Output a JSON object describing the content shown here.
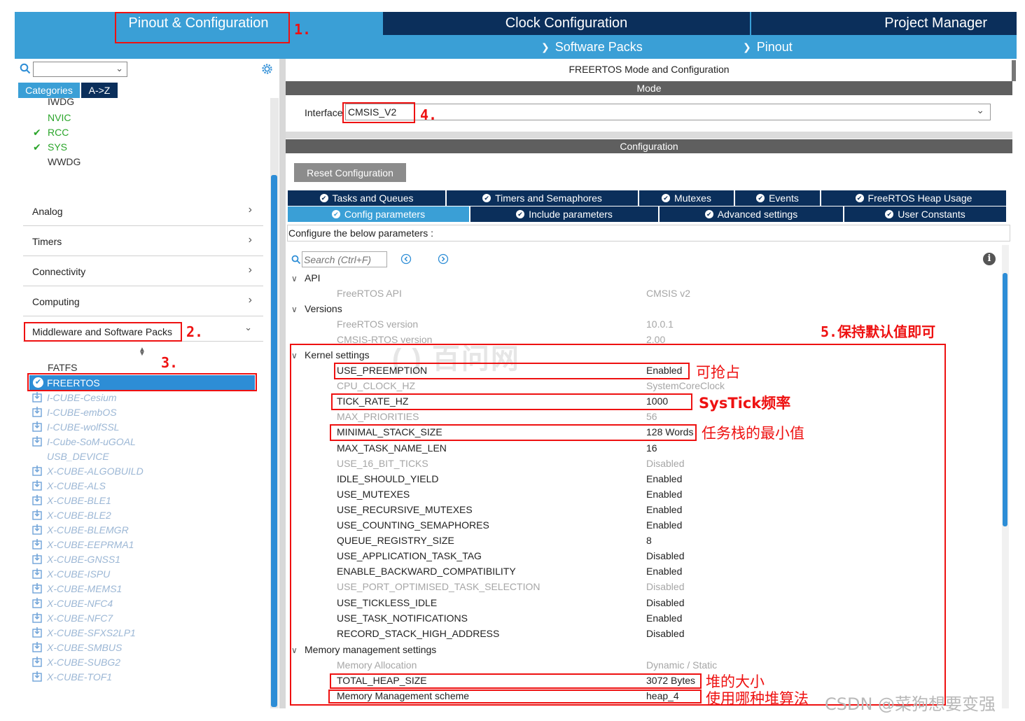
{
  "top_tabs": {
    "pinout": "Pinout & Configuration",
    "clock": "Clock Configuration",
    "project": "Project Manager",
    "software_packs": "Software Packs",
    "pinout_sub": "Pinout"
  },
  "left": {
    "search_value": "",
    "categories_tab": "Categories",
    "az_tab": "A->Z",
    "system_items": [
      "IWDG",
      "NVIC",
      "RCC",
      "SYS",
      "WWDG"
    ],
    "category_rows": [
      "Analog",
      "Timers",
      "Connectivity",
      "Computing",
      "Middleware and Software Packs"
    ],
    "middleware_items": {
      "fatfs": "FATFS",
      "freertos": "FREERTOS",
      "packs": [
        "I-CUBE-Cesium",
        "I-CUBE-embOS",
        "I-CUBE-wolfSSL",
        "I-Cube-SoM-uGOAL",
        "USB_DEVICE",
        "X-CUBE-ALGOBUILD",
        "X-CUBE-ALS",
        "X-CUBE-BLE1",
        "X-CUBE-BLE2",
        "X-CUBE-BLEMGR",
        "X-CUBE-EEPRMA1",
        "X-CUBE-GNSS1",
        "X-CUBE-ISPU",
        "X-CUBE-MEMS1",
        "X-CUBE-NFC4",
        "X-CUBE-NFC7",
        "X-CUBE-SFXS2LP1",
        "X-CUBE-SMBUS",
        "X-CUBE-SUBG2",
        "X-CUBE-TOF1"
      ]
    }
  },
  "right": {
    "title": "FREERTOS Mode and Configuration",
    "mode_header": "Mode",
    "interface_label": "Interface",
    "interface_value": "CMSIS_V2",
    "config_header": "Configuration",
    "reset_button": "Reset Configuration",
    "tabs_row1": [
      "Tasks and Queues",
      "Timers and Semaphores",
      "Mutexes",
      "Events",
      "FreeRTOS Heap Usage"
    ],
    "tabs_row2": [
      "Config parameters",
      "Include parameters",
      "Advanced settings",
      "User Constants"
    ],
    "configure_hint": "Configure the below parameters :",
    "search_placeholder": "Search (Ctrl+F)",
    "groups": {
      "api": "API",
      "versions": "Versions",
      "kernel": "Kernel settings",
      "memory": "Memory management settings"
    },
    "params": {
      "api": [
        {
          "name": "FreeRTOS API",
          "value": "CMSIS v2"
        }
      ],
      "versions": [
        {
          "name": "FreeRTOS version",
          "value": "10.0.1"
        },
        {
          "name": "CMSIS-RTOS version",
          "value": "2.00"
        }
      ],
      "kernel": [
        {
          "name": "USE_PREEMPTION",
          "value": "Enabled"
        },
        {
          "name": "CPU_CLOCK_HZ",
          "value": "SystemCoreClock"
        },
        {
          "name": "TICK_RATE_HZ",
          "value": "1000"
        },
        {
          "name": "MAX_PRIORITIES",
          "value": "56"
        },
        {
          "name": "MINIMAL_STACK_SIZE",
          "value": "128 Words"
        },
        {
          "name": "MAX_TASK_NAME_LEN",
          "value": "16"
        },
        {
          "name": "USE_16_BIT_TICKS",
          "value": "Disabled"
        },
        {
          "name": "IDLE_SHOULD_YIELD",
          "value": "Enabled"
        },
        {
          "name": "USE_MUTEXES",
          "value": "Enabled"
        },
        {
          "name": "USE_RECURSIVE_MUTEXES",
          "value": "Enabled"
        },
        {
          "name": "USE_COUNTING_SEMAPHORES",
          "value": "Enabled"
        },
        {
          "name": "QUEUE_REGISTRY_SIZE",
          "value": "8"
        },
        {
          "name": "USE_APPLICATION_TASK_TAG",
          "value": "Disabled"
        },
        {
          "name": "ENABLE_BACKWARD_COMPATIBILITY",
          "value": "Enabled"
        },
        {
          "name": "USE_PORT_OPTIMISED_TASK_SELECTION",
          "value": "Disabled"
        },
        {
          "name": "USE_TICKLESS_IDLE",
          "value": "Disabled"
        },
        {
          "name": "USE_TASK_NOTIFICATIONS",
          "value": "Enabled"
        },
        {
          "name": "RECORD_STACK_HIGH_ADDRESS",
          "value": "Disabled"
        }
      ],
      "memory": [
        {
          "name": "Memory Allocation",
          "value": "Dynamic / Static"
        },
        {
          "name": "TOTAL_HEAP_SIZE",
          "value": "3072 Bytes"
        },
        {
          "name": "Memory Management scheme",
          "value": "heap_4"
        }
      ]
    }
  },
  "annotations": {
    "a1": "1.",
    "a2": "2.",
    "a3": "3.",
    "a4": "4.",
    "a5": "5.保持默认值即可",
    "preemption": "可抢占",
    "systick": "SysTick频率",
    "stack": "任务栈的最小值",
    "heap_size": "堆的大小",
    "heap_scheme": "使用哪种堆算法"
  },
  "watermark": "CSDN @菜狗想要变强",
  "colors": {
    "topbar": "#3a9fd6",
    "dark_tab": "#0b2f5b",
    "annotation": "#e11111",
    "enabled_green": "#2aa52a"
  }
}
